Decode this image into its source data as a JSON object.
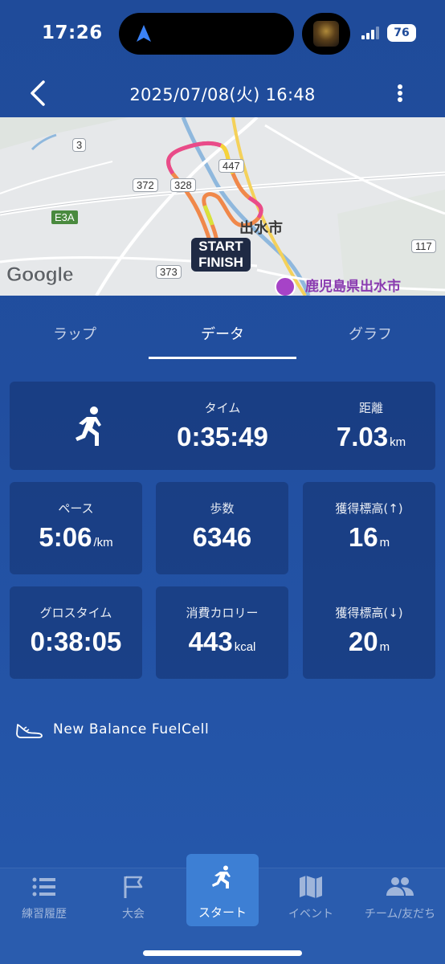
{
  "status_bar": {
    "time": "17:26",
    "battery": "76",
    "nav_arrow_icon": "navigation-arrow-icon",
    "signal_icon": "cellular-signal-icon"
  },
  "header": {
    "title": "2025/07/08(火) 16:48",
    "back_icon": "chevron-left-icon",
    "menu_icon": "more-vertical-icon"
  },
  "map": {
    "logo": "Google",
    "route_badge_start": "START",
    "route_badge_finish": "FINISH",
    "city_label": "出水市",
    "place_label": "鹿児島県出水市",
    "roads": {
      "r3": "3",
      "r447": "447",
      "r372": "372",
      "r328": "328",
      "e3a": "E3A",
      "r373": "373",
      "r117": "117"
    }
  },
  "tabs": [
    {
      "label": "ラップ",
      "active": false
    },
    {
      "label": "データ",
      "active": true
    },
    {
      "label": "グラフ",
      "active": false
    }
  ],
  "stats": {
    "activity_icon": "running-person-icon",
    "time": {
      "label": "タイム",
      "value": "0:35:49"
    },
    "distance": {
      "label": "距離",
      "value": "7.03",
      "unit": "km"
    },
    "pace": {
      "label": "ペース",
      "value": "5:06",
      "unit": "/km"
    },
    "steps": {
      "label": "歩数",
      "value": "6346"
    },
    "elev_gain": {
      "label": "獲得標高(↑)",
      "value": "16",
      "unit": "m"
    },
    "gross_time": {
      "label": "グロスタイム",
      "value": "0:38:05"
    },
    "calories": {
      "label": "消費カロリー",
      "value": "443",
      "unit": "kcal"
    },
    "elev_loss": {
      "label": "獲得標高(↓)",
      "value": "20",
      "unit": "m"
    }
  },
  "shoe": {
    "icon": "shoe-icon",
    "label": "New Balance FuelCell"
  },
  "bottom_nav": [
    {
      "label": "練習履歴",
      "icon": "list-icon",
      "active": false
    },
    {
      "label": "大会",
      "icon": "flag-icon",
      "active": false
    },
    {
      "label": "スタート",
      "icon": "running-person-icon",
      "active": true
    },
    {
      "label": "イベント",
      "icon": "map-icon",
      "active": false
    },
    {
      "label": "チーム/友だち",
      "icon": "people-icon",
      "active": false
    }
  ],
  "colors": {
    "background": "#1f4b9a",
    "card": "#173a80",
    "active_nav": "#3d7fd4",
    "route_orange": "#f0884a",
    "route_pink": "#e94b8a",
    "route_yellow": "#f5d33a"
  }
}
